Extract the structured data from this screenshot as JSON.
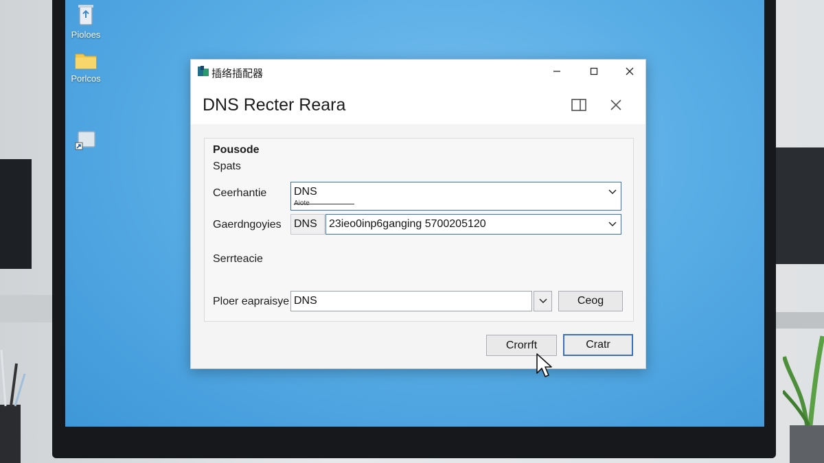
{
  "desktop": {
    "icons": [
      {
        "label": "Pioloes",
        "icon": "recycle-bin-icon"
      },
      {
        "label": "Porlcos",
        "icon": "folder-icon"
      },
      {
        "label": "",
        "icon": "shortcut-icon"
      }
    ]
  },
  "window": {
    "title": "插络插配器",
    "heading": "DNS Recter Reara",
    "section": {
      "title": "Pousode",
      "subtitle": "Spats"
    },
    "fields": {
      "first": {
        "label": "Ceerhantie",
        "value": "DNS",
        "hint": "Aiote"
      },
      "second": {
        "label": "Gaerdngoyies",
        "prefix": "DNS",
        "value": "23ieo0inp6ganging 5700205120"
      },
      "service_label": "Serrteacie",
      "third": {
        "label": "Ploer eapraisye",
        "value": "DNS",
        "button_label": "Ceog"
      }
    },
    "footer": {
      "secondary_button": "Crorrft",
      "primary_button": "Cratr"
    }
  },
  "colors": {
    "desktop_blue": "#5aaee6",
    "accent_border": "#3b6fb6",
    "bezel": "#16181b"
  }
}
